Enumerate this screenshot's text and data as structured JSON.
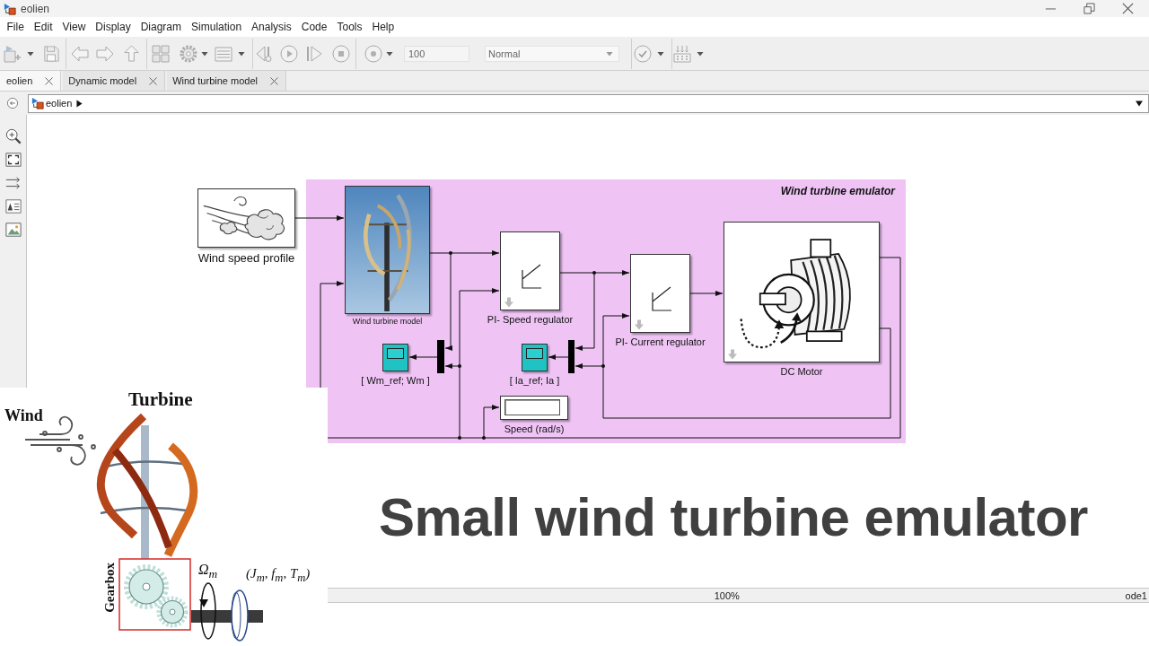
{
  "window": {
    "title": "eolien"
  },
  "menu": [
    "File",
    "Edit",
    "View",
    "Display",
    "Diagram",
    "Simulation",
    "Analysis",
    "Code",
    "Tools",
    "Help"
  ],
  "toolbar": {
    "stop_time": "100",
    "simulation_mode": "Normal"
  },
  "tabs": [
    {
      "label": "eolien",
      "selected": true
    },
    {
      "label": "Dynamic model",
      "selected": false
    },
    {
      "label": "Wind turbine model",
      "selected": false
    }
  ],
  "breadcrumb": [
    "eolien"
  ],
  "diagram": {
    "subsystem": {
      "title": "Wind turbine emulator"
    },
    "blocks": [
      {
        "kind": "wind-source",
        "label": "Wind speed profile"
      },
      {
        "kind": "turbine-photo",
        "label": "Wind turbine model"
      },
      {
        "kind": "pi-controller",
        "label": "PI- Speed regulator"
      },
      {
        "kind": "pi-controller",
        "label": "PI- Current regulator"
      },
      {
        "kind": "motor",
        "label": "DC Motor"
      },
      {
        "kind": "scope",
        "label": "[ Wm_ref; Wm ]"
      },
      {
        "kind": "mux"
      },
      {
        "kind": "scope",
        "label": "[ Ia_ref; Ia ]"
      },
      {
        "kind": "mux"
      },
      {
        "kind": "display",
        "label": "Speed (rad/s)"
      }
    ]
  },
  "status_bar": {
    "zoom": "100%",
    "solver": "ode1"
  },
  "inset": {
    "wind": "Wind",
    "turbine": "Turbine",
    "gearbox": "Gearbox",
    "speed": "Ω$_{m}$",
    "parameters": "(J$_{m}$, f$_{m}$, T$_{m}$)"
  },
  "headline": "Small wind turbine emulator"
}
